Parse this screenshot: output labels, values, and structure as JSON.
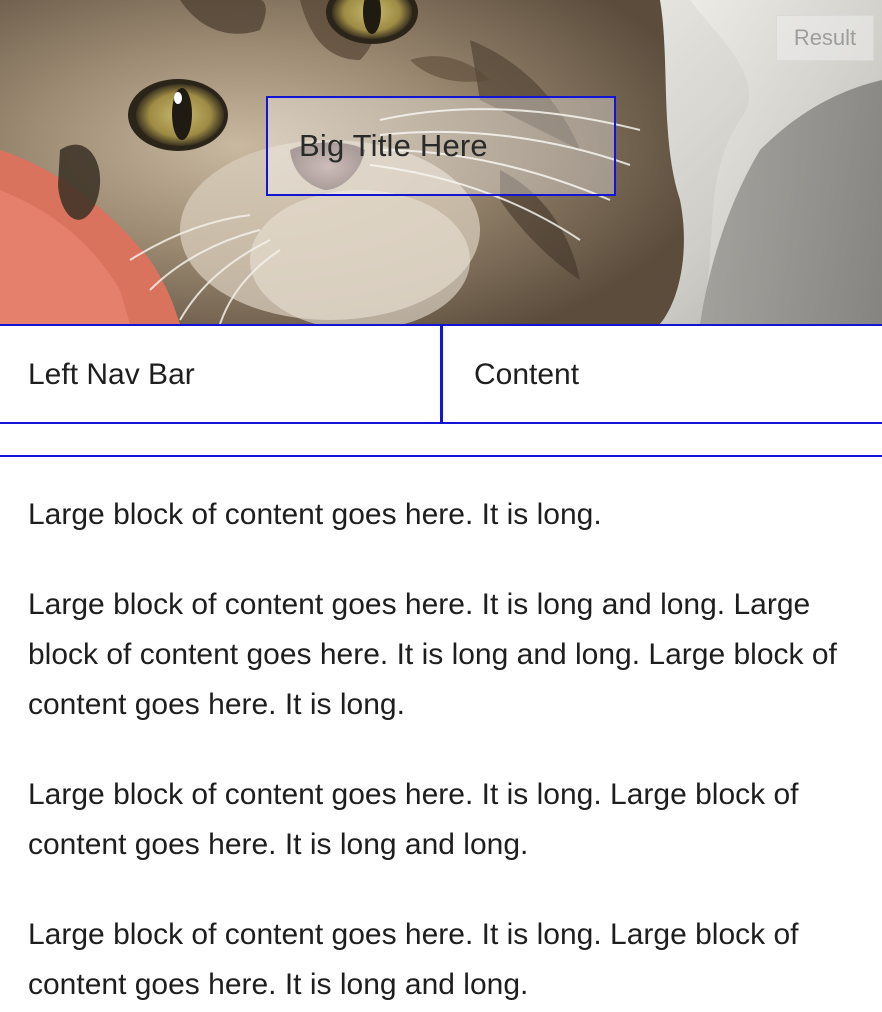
{
  "hero": {
    "image_name": "kitten-photo",
    "result_button": "Result",
    "title": "Big Title Here"
  },
  "nav": {
    "left_label": "Left Nav Bar",
    "content_label": "Content"
  },
  "body": {
    "paragraphs": [
      "Large block of content goes here. It is long.",
      "Large block of content goes here. It is long and long. Large block of content goes here. It is long and long. Large block of content goes here. It is long.",
      "Large block of content goes here. It is long. Large block of content goes here. It is long and long.",
      "Large block of content goes here. It is long. Large block of content goes here. It is long and long."
    ]
  },
  "colors": {
    "border_accent": "#1414d4",
    "text": "#1e1e1e",
    "background": "#ffffff"
  }
}
